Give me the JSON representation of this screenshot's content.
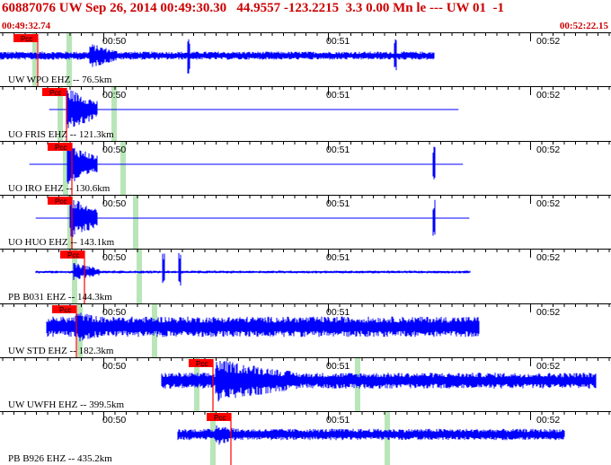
{
  "header": {
    "title": "60887076 UW Sep 26, 2014 00:49:30.30   44.9557 -123.2215  3.3 0.00 Mn le --- UW 01  -1",
    "time_start": "00:49:32.74",
    "time_end": "00:52:22.15"
  },
  "pick_label": "Pcc",
  "tick_labels": [
    "00:50",
    "00:51",
    "00:52"
  ],
  "colors": {
    "trace": "#0000ff",
    "pick": "#ff0000",
    "header_text": "#cc0000",
    "arrival_band": "#b8e6b8",
    "grid": "#000000"
  },
  "traces": [
    {
      "label": "UW WPO EHZ -- 76.5km",
      "amp": "medium"
    },
    {
      "label": "UO FRIS EHZ -- 121.3km",
      "amp": "high"
    },
    {
      "label": "UO IRO EHZ -- 130.6km",
      "amp": "high"
    },
    {
      "label": "UO HUO EHZ -- 143.1km",
      "amp": "high"
    },
    {
      "label": "PB B031 EHZ -- 144.3km",
      "amp": "low"
    },
    {
      "label": "UW STD EHZ -- 182.3km",
      "amp": "medium"
    },
    {
      "label": "UW UWFH EHZ -- 399.5km",
      "amp": "medium"
    },
    {
      "label": "PB B926 EHZ -- 435.2km",
      "amp": "low"
    }
  ]
}
